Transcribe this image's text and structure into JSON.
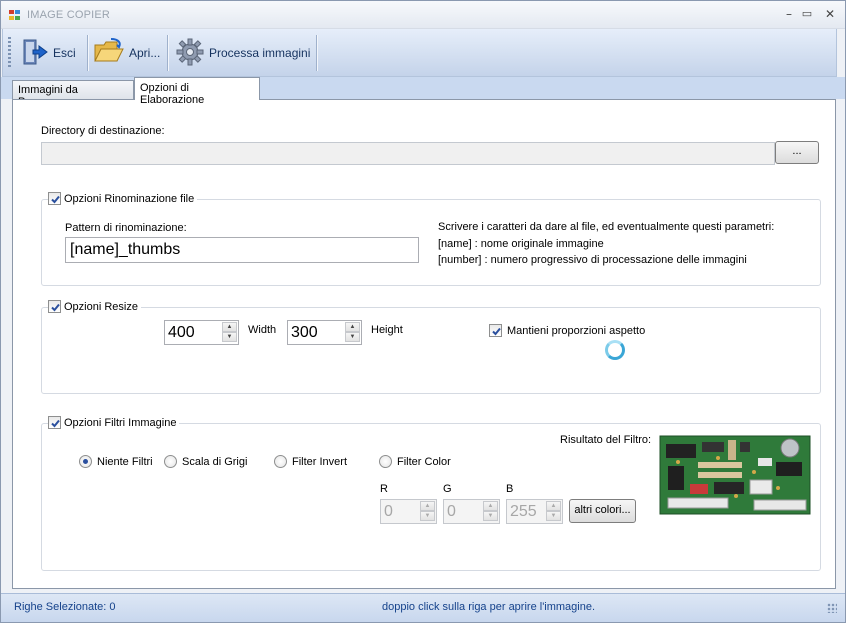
{
  "window": {
    "title": "IMAGE COPIER",
    "buttons": {
      "minimize": "–",
      "maximize": "▭",
      "close": "✕"
    }
  },
  "toolbar": {
    "exit_label": "Esci",
    "open_label": "Apri...",
    "process_label": "Processa immagini"
  },
  "tabs": [
    {
      "label": "Immagini da Processare",
      "active": false
    },
    {
      "label": "Opzioni di Elaborazione",
      "active": true
    }
  ],
  "destination": {
    "label": "Directory di destinazione:",
    "value": "",
    "browse_label": "..."
  },
  "rename": {
    "group_label": "Opzioni Rinominazione file",
    "checked": true,
    "pattern_label": "Pattern di rinominazione:",
    "pattern_value": "[name]_thumbs",
    "help_line1": "Scrivere i caratteri da dare al file, ed eventualmente questi parametri:",
    "help_line2": "[name] : nome originale immagine",
    "help_line3": "[number] : numero progressivo di processazione delle immagini"
  },
  "resize": {
    "group_label": "Opzioni Resize",
    "checked": true,
    "width_value": "400",
    "width_label": "Width",
    "height_value": "300",
    "height_label": "Height",
    "keep_ratio_label": "Mantieni proporzioni aspetto",
    "keep_ratio_checked": true
  },
  "filters": {
    "group_label": "Opzioni Filtri Immagine",
    "checked": true,
    "options": [
      "Niente Filtri",
      "Scala di Grigi",
      "Filter Invert",
      "Filter Color"
    ],
    "selected": "Niente Filtri",
    "r_label": "R",
    "r_value": "0",
    "g_label": "G",
    "g_value": "0",
    "b_label": "B",
    "b_value": "255",
    "more_colors_label": "altri colori...",
    "result_label": "Risultato del Filtro:"
  },
  "status": {
    "selected_rows": "Righe Selezionate:  0",
    "hint": "doppio click sulla riga per aprire l'immagine."
  },
  "colors": {
    "accent": "#15428b",
    "toolbar": "#d2def0",
    "check": "#2a4f9e"
  }
}
